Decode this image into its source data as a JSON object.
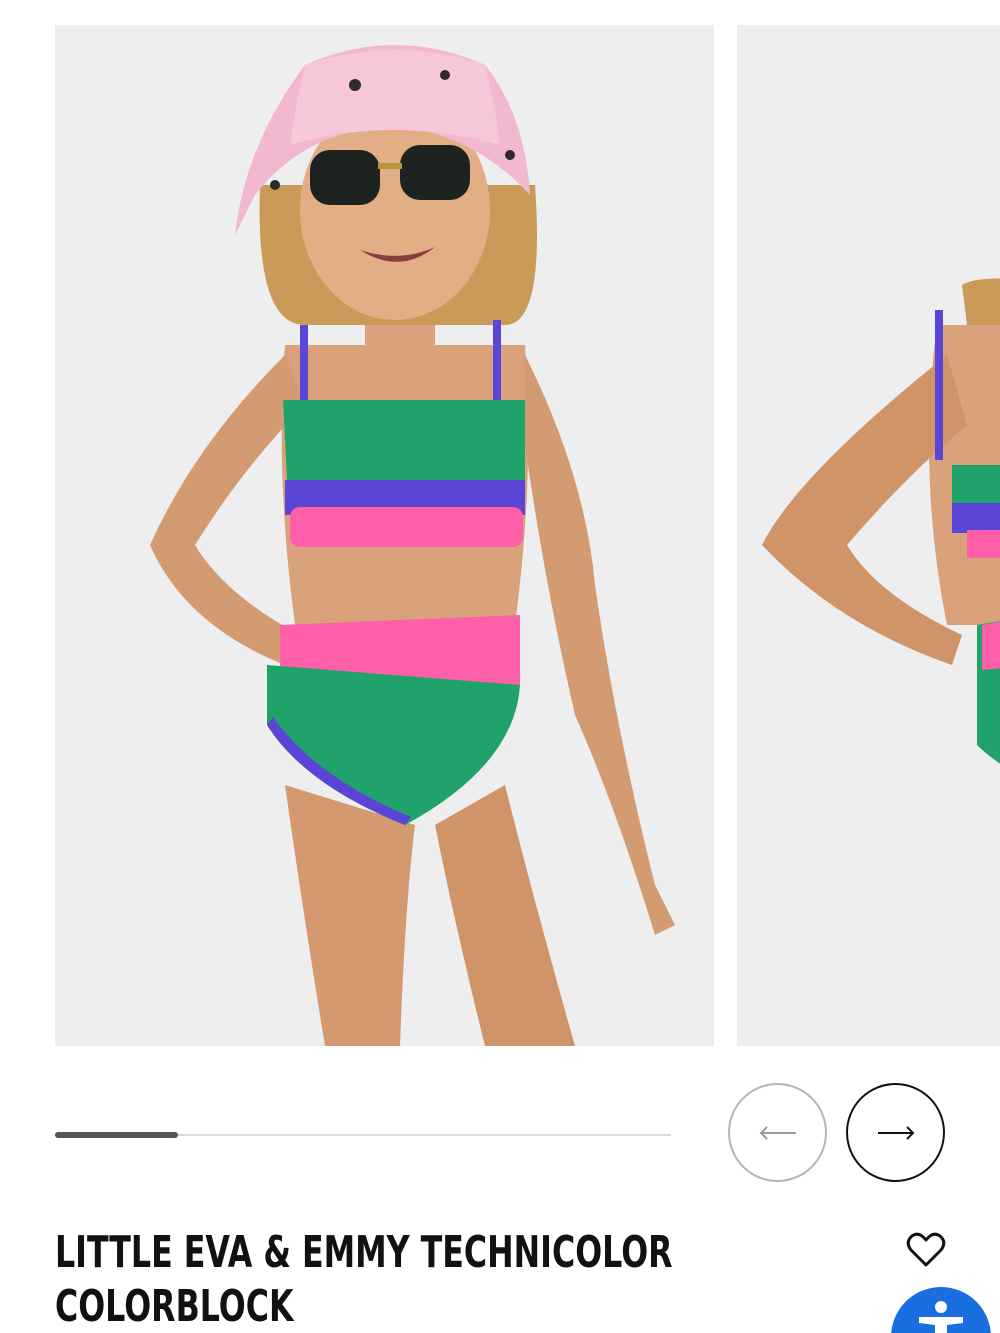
{
  "gallery": {
    "slides": [
      {
        "alt": "Little Eva & Emmy Technicolor Colorblock - front view"
      },
      {
        "alt": "Little Eva & Emmy Technicolor Colorblock - back view"
      }
    ],
    "progress": 0.2,
    "colors": {
      "green": "#1fa36b",
      "purple": "#5b45d6",
      "pink": "#ff5fa8",
      "skin": "#d9a27a",
      "hat": "#f2b8cf"
    }
  },
  "nav": {
    "prev_icon": "arrow-left-icon",
    "next_icon": "arrow-right-icon"
  },
  "product": {
    "title": "LITTLE EVA & EMMY TECHNICOLOR COLORBLOCK",
    "wishlist_icon": "heart-icon"
  },
  "accessibility": {
    "icon": "accessibility-icon",
    "color": "#1a6fe0"
  }
}
